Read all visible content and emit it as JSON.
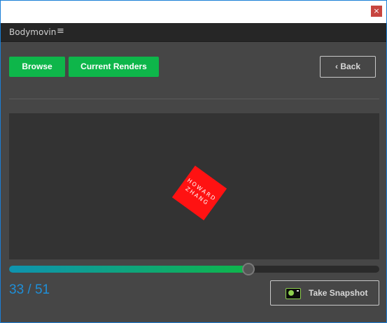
{
  "window": {
    "close_glyph": "×"
  },
  "panel": {
    "title": "Bodymovin",
    "menu_glyph": "≡"
  },
  "toolbar": {
    "browse_label": "Browse",
    "current_renders_label": "Current Renders",
    "back_label": "‹ Back"
  },
  "preview": {
    "logo_line1": "HOWARD",
    "logo_line2": "ZHANG",
    "logo_color": "#ff1212"
  },
  "timeline": {
    "current_frame": 33,
    "total_frames": 51,
    "counter_text": "33 / 51",
    "progress": 0.647
  },
  "snapshot": {
    "label": "Take Snapshot",
    "icon": "camera-icon"
  },
  "colors": {
    "accent_green": "#0eb64a",
    "accent_blue": "#1f8fd8",
    "panel_bg": "#464646",
    "preview_bg": "#333333"
  }
}
